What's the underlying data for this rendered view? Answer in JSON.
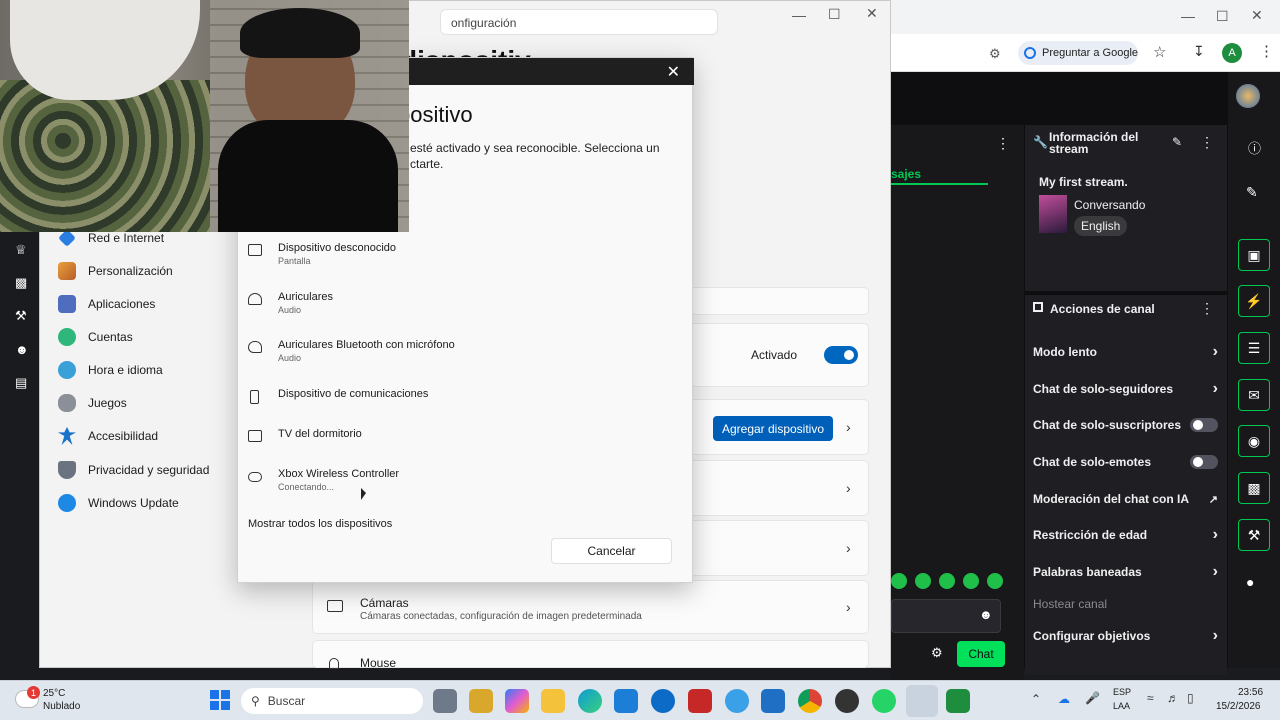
{
  "settings": {
    "search_text": "onfiguración",
    "heading": "dispositiv",
    "sidebar": [
      "Red e Internet",
      "Personalización",
      "Aplicaciones",
      "Cuentas",
      "Hora e idioma",
      "Juegos",
      "Accesibilidad",
      "Privacidad y seguridad",
      "Windows Update"
    ],
    "bluetooth_state": "Activado",
    "add_device": "Agregar dispositivo",
    "cameras_title": "Cámaras",
    "cameras_sub": "Cámaras conectadas, configuración de imagen predeterminada",
    "mouse_title": "Mouse"
  },
  "dialog": {
    "title": "positivo",
    "desc": "esté activado y sea reconocible. Selecciona un\nctarte.",
    "devices": [
      {
        "name": "Dispositivo desconocido",
        "sub": "Pantalla",
        "icon": "monitor-icon"
      },
      {
        "name": "Auriculares",
        "sub": "Audio",
        "icon": "headphones-icon"
      },
      {
        "name": "Auriculares Bluetooth con micrófono",
        "sub": "Audio",
        "icon": "headset-icon"
      },
      {
        "name": "Dispositivo de comunicaciones",
        "sub": "",
        "icon": "phone-icon"
      },
      {
        "name": "TV del dormitorio",
        "sub": "",
        "icon": "monitor-icon"
      },
      {
        "name": "Xbox Wireless Controller",
        "sub": "Conectando...",
        "icon": "gamepad-icon"
      }
    ],
    "show_all": "Mostrar todos los dispositivos",
    "cancel": "Cancelar"
  },
  "browser": {
    "ask_google": "Preguntar a Google",
    "avatar_letter": "A",
    "chat_tab": "sajes",
    "stream_info_title": "Información del stream",
    "stream_title": "My first stream.",
    "category": "Conversando",
    "language": "English",
    "channel_actions": "Acciones de canal",
    "actions": [
      {
        "label": "Modo lento",
        "control": "chevron"
      },
      {
        "label": "Chat de solo-seguidores",
        "control": "chevron"
      },
      {
        "label": "Chat de solo-suscriptores",
        "control": "toggle"
      },
      {
        "label": "Chat de solo-emotes",
        "control": "toggle"
      },
      {
        "label": "Moderación del chat con IA",
        "control": "external"
      },
      {
        "label": "Restricción de edad",
        "control": "chevron"
      },
      {
        "label": "Palabras baneadas",
        "control": "chevron"
      },
      {
        "label": "Hostear canal",
        "control": "none"
      },
      {
        "label": "Configurar objetivos",
        "control": "chevron"
      }
    ],
    "chat_button": "Chat"
  },
  "taskbar": {
    "weather_temp": "25°C",
    "weather_desc": "Nublado",
    "weather_badge": "1",
    "search_placeholder": "Buscar",
    "lang_top": "ESP",
    "lang_bottom": "LAA",
    "time": "23:56",
    "date": "15/2/2026"
  },
  "colors": {
    "accent_blue": "#005fb8",
    "twitch_green": "#00c853"
  }
}
